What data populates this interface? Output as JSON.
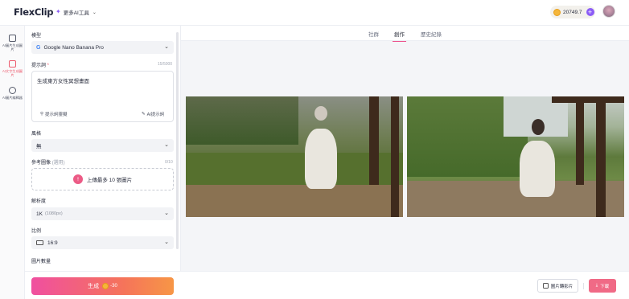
{
  "header": {
    "logo": "FlexClip",
    "more_tools": "更多AI工具",
    "credits": "20749.7"
  },
  "rail": {
    "items": [
      {
        "label": "AI圖片生成圖片",
        "active": false,
        "icon": "image-to-image-icon"
      },
      {
        "label": "AI文字生成圖片",
        "active": true,
        "icon": "text-to-image-icon"
      },
      {
        "label": "AI圖片編輯器",
        "active": false,
        "icon": "image-editor-icon"
      }
    ]
  },
  "settings": {
    "model_label": "模型",
    "model_value": "Google Nano Banana Pro",
    "prompt_label": "提示詞",
    "prompt_counter": "15/5000",
    "prompt_value": "生成東方女性冥想畫面",
    "prompt_inspiration": "提示詞靈擬",
    "ai_prompt": "AI提示詞",
    "style_label": "風格",
    "style_value": "無",
    "reference_label": "參考圖像",
    "reference_optional": "(選用)",
    "reference_counter": "0/10",
    "upload_text": "上傳最多 10 張圖片",
    "resolution_label": "解析度",
    "resolution_value": "1K",
    "resolution_sub": "(1080px)",
    "ratio_label": "比例",
    "ratio_value": "16:9",
    "count_label": "圖片數量",
    "generate_label": "生成",
    "generate_cost": "-30"
  },
  "main": {
    "tabs": [
      {
        "label": "社群",
        "active": false
      },
      {
        "label": "創作",
        "active": true
      },
      {
        "label": "歷史紀錄",
        "active": false
      }
    ],
    "convert_label": "圖片轉影片",
    "download_label": "下載"
  },
  "colors": {
    "accent": "#ec4f8a",
    "credit_plus": "#8b5cf6",
    "download": "#f06a86"
  }
}
